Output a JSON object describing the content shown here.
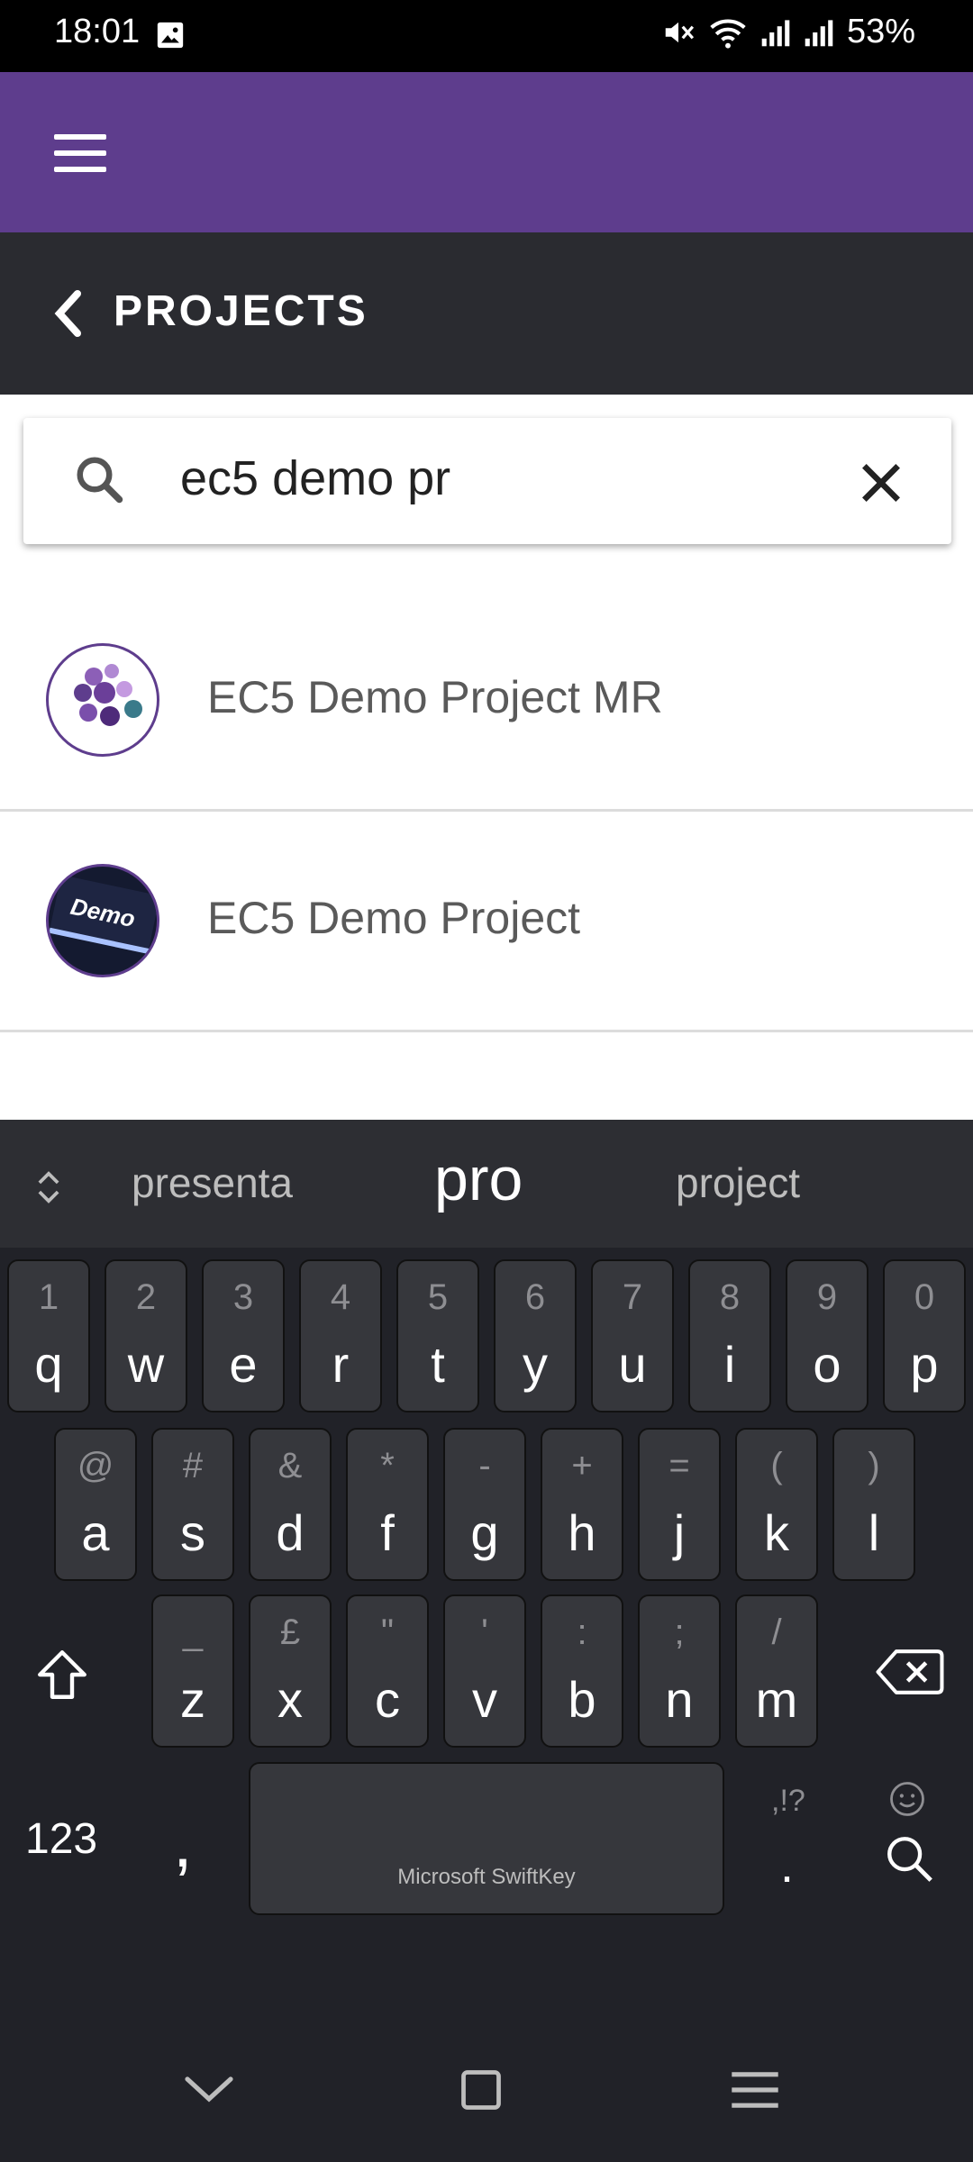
{
  "status_bar": {
    "time": "18:01",
    "battery": "53%"
  },
  "header": {
    "section_title": "PROJECTS"
  },
  "search": {
    "value": "ec5 demo pr"
  },
  "projects": [
    {
      "name": "EC5 Demo Project MR"
    },
    {
      "name": "EC5 Demo Project",
      "avatar_text": "Demo"
    }
  ],
  "keyboard": {
    "suggestions": [
      "presenta",
      "pro",
      "project"
    ],
    "row1": [
      {
        "hint": "1",
        "key": "q"
      },
      {
        "hint": "2",
        "key": "w"
      },
      {
        "hint": "3",
        "key": "e"
      },
      {
        "hint": "4",
        "key": "r"
      },
      {
        "hint": "5",
        "key": "t"
      },
      {
        "hint": "6",
        "key": "y"
      },
      {
        "hint": "7",
        "key": "u"
      },
      {
        "hint": "8",
        "key": "i"
      },
      {
        "hint": "9",
        "key": "o"
      },
      {
        "hint": "0",
        "key": "p"
      }
    ],
    "row2": [
      {
        "hint": "@",
        "key": "a"
      },
      {
        "hint": "#",
        "key": "s"
      },
      {
        "hint": "&",
        "key": "d"
      },
      {
        "hint": "*",
        "key": "f"
      },
      {
        "hint": "-",
        "key": "g"
      },
      {
        "hint": "+",
        "key": "h"
      },
      {
        "hint": "=",
        "key": "j"
      },
      {
        "hint": "(",
        "key": "k"
      },
      {
        "hint": ")",
        "key": "l"
      }
    ],
    "row3": [
      {
        "hint": "_",
        "key": "z"
      },
      {
        "hint": "£",
        "key": "x"
      },
      {
        "hint": "\"",
        "key": "c"
      },
      {
        "hint": "'",
        "key": "v"
      },
      {
        "hint": ":",
        "key": "b"
      },
      {
        "hint": ";",
        "key": "n"
      },
      {
        "hint": "/",
        "key": "m"
      }
    ],
    "numbers_label": "123",
    "comma": ",",
    "space_label": "Microsoft SwiftKey",
    "punct_hint": ",!?",
    "period": "."
  },
  "colors": {
    "app_bar": "#5e3d8d",
    "section_header": "#2a2b30",
    "keyboard_bg": "#212228"
  }
}
